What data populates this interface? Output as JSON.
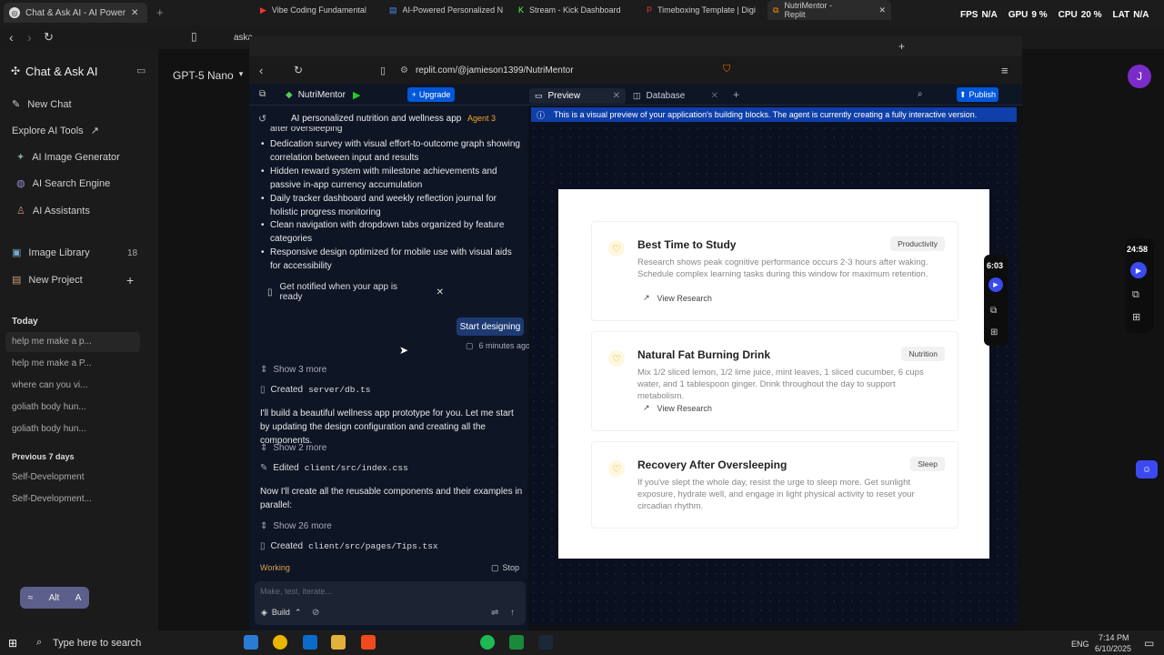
{
  "outer_browser": {
    "tab_title": "Chat & Ask AI - AI Powered Cha",
    "stats": {
      "fps": "FPS",
      "fps_val": "N/A",
      "gpu": "GPU",
      "gpu_val": "9 %",
      "cpu": "CPU",
      "cpu_val": "20 %",
      "lat": "LAT",
      "lat_val": "N/A"
    },
    "url_fragment": "aska"
  },
  "sidebar": {
    "app_title": "Chat & Ask AI",
    "model": "GPT-5 Nano",
    "new_chat": "New Chat",
    "explore": "Explore AI Tools",
    "tools": [
      "AI Image Generator",
      "AI Search Engine",
      "AI Assistants"
    ],
    "image_library": "Image Library",
    "image_count": "18",
    "new_project": "New Project",
    "today_label": "Today",
    "today_items": [
      "help me make a p...",
      "help me make a P...",
      "where can you vi...",
      "goliath body hun...",
      "goliath body hun..."
    ],
    "prev_label": "Previous 7 days",
    "prev_items": [
      "Self-Development",
      "Self-Development..."
    ],
    "bottom_alt": "Alt",
    "bottom_a": "A"
  },
  "inner_browser": {
    "tabs": [
      "Vibe Coding Fundamental",
      "AI-Powered Personalized Nutri",
      "Stream - Kick Dashboard",
      "Timeboxing Template | Digital",
      "NutriMentor - Replit"
    ],
    "url": "replit.com/@jamieson1399/NutriMentor"
  },
  "replit": {
    "project": "NutriMentor",
    "upgrade": "Upgrade",
    "preview_tab": "Preview",
    "database_tab": "Database",
    "publish": "Publish",
    "chat_title": "AI personalized nutrition and wellness app",
    "agent": "Agent 3",
    "notice": "This is a visual preview of your application's building blocks. The agent is currently creating a fully interactive version."
  },
  "chat": {
    "cut_line": "after oversleeping",
    "bullets": [
      "Dedication survey with visual effort-to-outcome graph showing correlation between input and results",
      "Hidden reward system with milestone achievements and passive in-app currency accumulation",
      "Daily tracker dashboard and weekly reflection journal for holistic progress monitoring",
      "Clean navigation with dropdown tabs organized by feature categories",
      "Responsive design optimized for mobile use with visual aids for accessibility"
    ],
    "notify": "Get notified when your app is ready",
    "start_designing": "Start designing",
    "time_ago": "6 minutes ago",
    "show_more_1": "Show 3 more",
    "created_1_prefix": "Created",
    "created_1_file": "server/db.ts",
    "msg_1": "I'll build a beautiful wellness app prototype for you. Let me start by updating the design configuration and creating all the components.",
    "show_more_2": "Show 2 more",
    "edited_prefix": "Edited",
    "edited_file": "client/src/index.css",
    "msg_2": "Now I'll create all the reusable components and their examples in parallel:",
    "show_more_3": "Show 26 more",
    "created_2_prefix": "Created",
    "created_2_file": "client/src/pages/Tips.tsx",
    "working": "Working",
    "stop": "Stop",
    "input_placeholder": "Make, test, iterate...",
    "build": "Build"
  },
  "tips": [
    {
      "title": "Best Time to Study",
      "badge": "Productivity",
      "body": "Research shows peak cognitive performance occurs 2-3 hours after waking. Schedule complex learning tasks during this window for maximum retention.",
      "link": "View Research"
    },
    {
      "title": "Natural Fat Burning Drink",
      "badge": "Nutrition",
      "body": "Mix 1/2 sliced lemon, 1/2 lime juice, mint leaves, 1 sliced cucumber, 6 cups water, and 1 tablespoon ginger. Drink throughout the day to support metabolism.",
      "link": "View Research"
    },
    {
      "title": "Recovery After Oversleeping",
      "badge": "Sleep",
      "body": "If you've slept the whole day, resist the urge to sleep more. Get sunlight exposure, hydrate well, and engage in light physical activity to reset your circadian rhythm.",
      "link": ""
    }
  ],
  "right_panel": {
    "timer": "24:58",
    "sub_timer": "6:03",
    "avatar": "J"
  },
  "taskbar": {
    "search": "Type here to search",
    "lang": "ENG",
    "time": "7:14 PM",
    "date": "6/10/2025"
  },
  "colors": {
    "accent": "#0079f2",
    "bg": "#0e1525",
    "notice": "#0f3fa8"
  }
}
